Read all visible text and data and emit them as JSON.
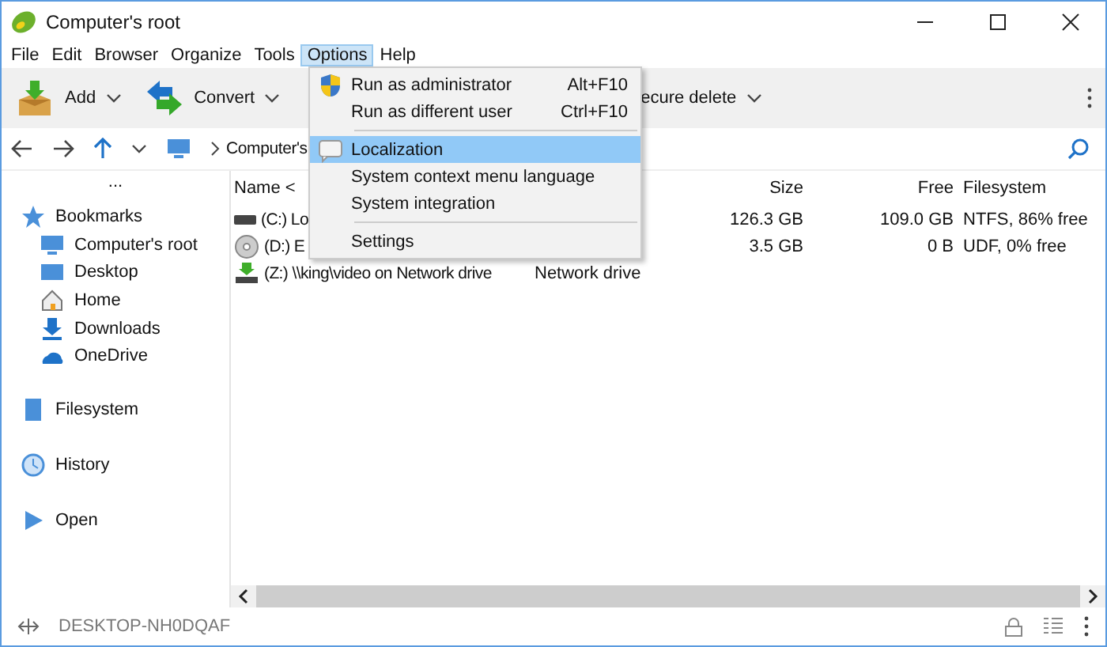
{
  "window": {
    "title": "Computer's root"
  },
  "menubar": [
    {
      "label": "File",
      "selected": false
    },
    {
      "label": "Edit",
      "selected": false
    },
    {
      "label": "Browser",
      "selected": false
    },
    {
      "label": "Organize",
      "selected": false
    },
    {
      "label": "Tools",
      "selected": false
    },
    {
      "label": "Options",
      "selected": true
    },
    {
      "label": "Help",
      "selected": false
    }
  ],
  "toolbar": [
    {
      "label": "Add",
      "kind": "add"
    },
    {
      "label": "Convert",
      "kind": "convert"
    },
    {
      "label": "ecure delete",
      "kind": "plain"
    }
  ],
  "address": {
    "crumb": "Computer's"
  },
  "sidebar": {
    "more": "...",
    "sections": [
      {
        "label": "Bookmarks",
        "kind": "star",
        "children": [
          {
            "label": "Computer's root",
            "kind": "monitor"
          },
          {
            "label": "Desktop",
            "kind": "desktop"
          },
          {
            "label": "Home",
            "kind": "home"
          },
          {
            "label": "Downloads",
            "kind": "download"
          },
          {
            "label": "OneDrive",
            "kind": "cloud"
          }
        ]
      },
      {
        "label": "Filesystem",
        "kind": "fs"
      },
      {
        "label": "History",
        "kind": "clock"
      },
      {
        "label": "Open",
        "kind": "play"
      }
    ]
  },
  "table": {
    "columns": [
      "Name <",
      "Size",
      "Free",
      "Filesystem"
    ],
    "rows": [
      {
        "kind": "disk",
        "name": "(C:) Lo",
        "size": "126.3 GB",
        "free": "109.0 GB",
        "filesystem": "NTFS, 86% free"
      },
      {
        "kind": "cd",
        "name": "(D:) E",
        "size": "3.5 GB",
        "free": "0 B",
        "filesystem": "UDF, 0% free"
      },
      {
        "kind": "net",
        "name": "(Z:) \\\\king\\video on Network drive",
        "type": "Network drive"
      }
    ]
  },
  "menu": {
    "items": [
      {
        "kind": "shield",
        "label": "Run as administrator",
        "shortcut": "Alt+F10",
        "selected": false
      },
      {
        "kind": "item",
        "label": "Run as different user",
        "shortcut": "Ctrl+F10",
        "selected": false
      },
      {
        "kind": "separator"
      },
      {
        "kind": "bubble",
        "label": "Localization",
        "selected": true
      },
      {
        "kind": "item",
        "label": "System context menu language",
        "selected": false
      },
      {
        "kind": "item",
        "label": "System integration",
        "selected": false
      },
      {
        "kind": "separator"
      },
      {
        "kind": "item",
        "label": "Settings",
        "selected": false
      }
    ]
  },
  "status_bar": {
    "computer": "DESKTOP-NH0DQAF"
  }
}
